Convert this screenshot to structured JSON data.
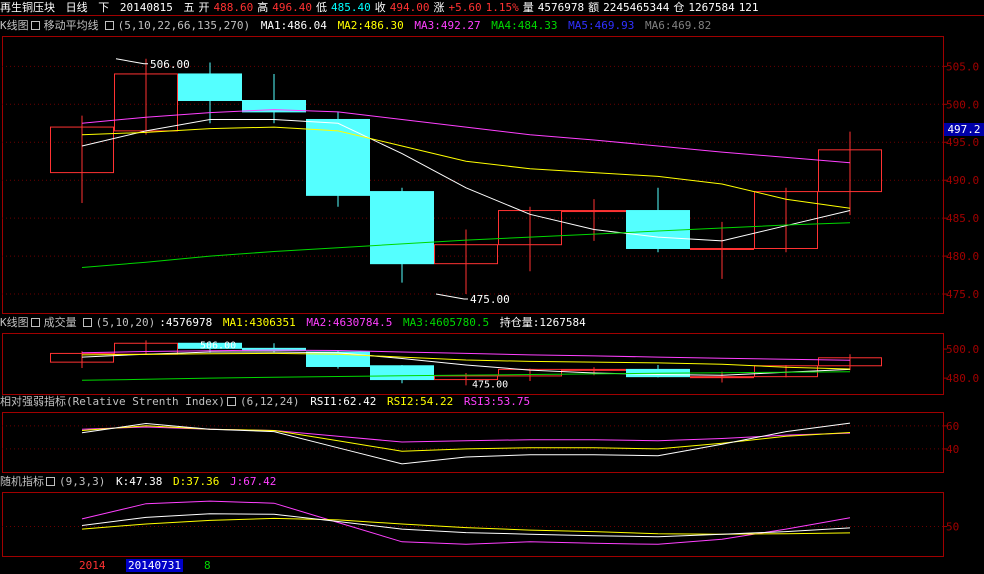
{
  "header": {
    "name": "再生铜压块",
    "period": "日线",
    "down": "下",
    "date": "20140815",
    "weekday": "五",
    "open_label": "开",
    "open": "488.60",
    "high_label": "高",
    "high": "496.40",
    "low_label": "低",
    "low": "485.40",
    "close_label": "收",
    "close": "494.00",
    "change_label": "涨",
    "change": "+5.60",
    "pct": "1.15%",
    "vol_label": "量",
    "vol": "4576978",
    "amt_label": "额",
    "amt": "2245465344",
    "oi_label": "仓",
    "oi": "1267584",
    "extra": "121"
  },
  "price_panel": {
    "tag": "K线图",
    "indicator": "移动平均线",
    "params": "(5,10,22,66,135,270)",
    "ma1": "MA1:486.04",
    "ma2": "MA2:486.30",
    "ma3": "MA3:492.27",
    "ma4": "MA4:484.33",
    "ma5": "MA5:469.93",
    "ma6": "MA6:469.82",
    "last_price": "497.2"
  },
  "volume_panel": {
    "tag": "K线图",
    "indicator": "成交量",
    "params": "(5,10,20)",
    "vol": ":4576978",
    "ma1": "MA1:4306351",
    "ma2": "MA2:4630784.5",
    "ma3": "MA3:4605780.5",
    "oi_label": "持仓量",
    "oi": ":1267584"
  },
  "rsi_panel": {
    "title": "相对强弱指标(Relative Strenth Index)",
    "params": "(6,12,24)",
    "rsi1": "RSI1:62.42",
    "rsi2": "RSI2:54.22",
    "rsi3": "RSI3:53.75"
  },
  "kdj_panel": {
    "title": "随机指标",
    "params": "(9,3,3)",
    "k": "K:47.38",
    "d": "D:37.36",
    "j": "J:67.42"
  },
  "footer": {
    "year": "2014",
    "date": "20140731",
    "num": "8"
  },
  "colors": {
    "up": "#ff3232",
    "down": "#54ffff",
    "ma1": "#ffffff",
    "ma2": "#ffff00",
    "ma3": "#ff40ff",
    "ma4": "#00d800",
    "border": "#a00000"
  },
  "chart_data": [
    {
      "type": "candlestick",
      "title": "移动平均线",
      "ylim": [
        472.5,
        509
      ],
      "yticks": [
        475,
        480,
        485,
        490,
        495,
        500,
        505
      ],
      "ytick_labels": [
        "475.0",
        "480.0",
        "485.0",
        "490.0",
        "495.0",
        "500.0",
        "505.0"
      ],
      "annotations": [
        {
          "text": "506.00",
          "at_index": 1
        },
        {
          "text": "475.00",
          "at_index": 6
        }
      ],
      "candles": [
        {
          "o": 491.0,
          "h": 498.5,
          "l": 487.0,
          "c": 497.0
        },
        {
          "o": 496.5,
          "h": 506.0,
          "l": 496.0,
          "c": 504.0
        },
        {
          "o": 504.0,
          "h": 505.5,
          "l": 497.5,
          "c": 500.5
        },
        {
          "o": 500.5,
          "h": 504.0,
          "l": 497.5,
          "c": 499.0
        },
        {
          "o": 498.0,
          "h": 499.0,
          "l": 486.5,
          "c": 488.0
        },
        {
          "o": 488.5,
          "h": 489.0,
          "l": 476.5,
          "c": 479.0
        },
        {
          "o": 479.0,
          "h": 483.5,
          "l": 475.0,
          "c": 481.5
        },
        {
          "o": 481.5,
          "h": 486.5,
          "l": 478.0,
          "c": 486.0
        },
        {
          "o": 486.0,
          "h": 487.5,
          "l": 482.0,
          "c": 486.0
        },
        {
          "o": 486.0,
          "h": 489.0,
          "l": 480.5,
          "c": 481.0
        },
        {
          "o": 481.0,
          "h": 484.5,
          "l": 477.0,
          "c": 481.0
        },
        {
          "o": 481.0,
          "h": 489.0,
          "l": 480.5,
          "c": 488.5
        },
        {
          "o": 488.5,
          "h": 496.4,
          "l": 485.4,
          "c": 494.0
        }
      ],
      "series": [
        {
          "name": "MA1",
          "color": "#ffffff",
          "values": [
            494.5,
            496.5,
            498.0,
            498.0,
            497.5,
            493.5,
            489.0,
            485.5,
            483.5,
            482.5,
            482.0,
            484.0,
            486.0
          ]
        },
        {
          "name": "MA2",
          "color": "#ffff00",
          "values": [
            496.0,
            496.3,
            496.8,
            497.0,
            496.5,
            494.5,
            492.5,
            491.5,
            491.0,
            490.5,
            489.5,
            487.5,
            486.3
          ]
        },
        {
          "name": "MA3",
          "color": "#ff40ff",
          "values": [
            497.5,
            498.3,
            498.9,
            499.3,
            499.0,
            498.0,
            497.0,
            496.0,
            495.3,
            494.5,
            493.7,
            493.0,
            492.3
          ]
        },
        {
          "name": "MA4",
          "color": "#00d800",
          "values": [
            478.5,
            479.2,
            480.0,
            480.6,
            481.1,
            481.6,
            482.1,
            482.5,
            482.9,
            483.3,
            483.7,
            484.1,
            484.4
          ]
        }
      ]
    },
    {
      "type": "volume",
      "title": "成交量",
      "ytick_labels": [
        "480.0",
        "500.0"
      ],
      "annotations": [
        {
          "text": "506.00",
          "at_index": 2
        },
        {
          "text": "475.00",
          "at_index": 7
        }
      ]
    },
    {
      "type": "line",
      "title": "RSI",
      "ytick_labels": [
        "40",
        "60"
      ],
      "ylim": [
        20,
        72
      ],
      "series": [
        {
          "name": "RSI1",
          "color": "#ffffff",
          "values": [
            54,
            62,
            57,
            55,
            41,
            27,
            33,
            35,
            35,
            34,
            44,
            55,
            62.4
          ]
        },
        {
          "name": "RSI2",
          "color": "#ffff00",
          "values": [
            56,
            60,
            57,
            56,
            47,
            38,
            40,
            41,
            41,
            40,
            45,
            51,
            54.2
          ]
        },
        {
          "name": "RSI3",
          "color": "#ff40ff",
          "values": [
            57,
            59,
            57,
            56,
            51,
            46,
            47,
            48,
            48,
            47,
            49,
            52,
            53.75
          ]
        }
      ]
    },
    {
      "type": "line",
      "title": "KDJ",
      "ytick_labels": [
        "50"
      ],
      "ylim": [
        -8,
        118
      ],
      "series": [
        {
          "name": "K",
          "color": "#ffffff",
          "values": [
            52,
            68,
            75,
            74,
            60,
            45,
            38,
            35,
            32,
            30,
            35,
            40,
            47.4
          ]
        },
        {
          "name": "D",
          "color": "#ffff00",
          "values": [
            45,
            55,
            62,
            66,
            63,
            55,
            48,
            43,
            40,
            36,
            35,
            36,
            37.4
          ]
        },
        {
          "name": "J",
          "color": "#ff40ff",
          "values": [
            65,
            95,
            100,
            96,
            58,
            20,
            15,
            20,
            17,
            15,
            25,
            45,
            67.4
          ]
        }
      ]
    }
  ]
}
